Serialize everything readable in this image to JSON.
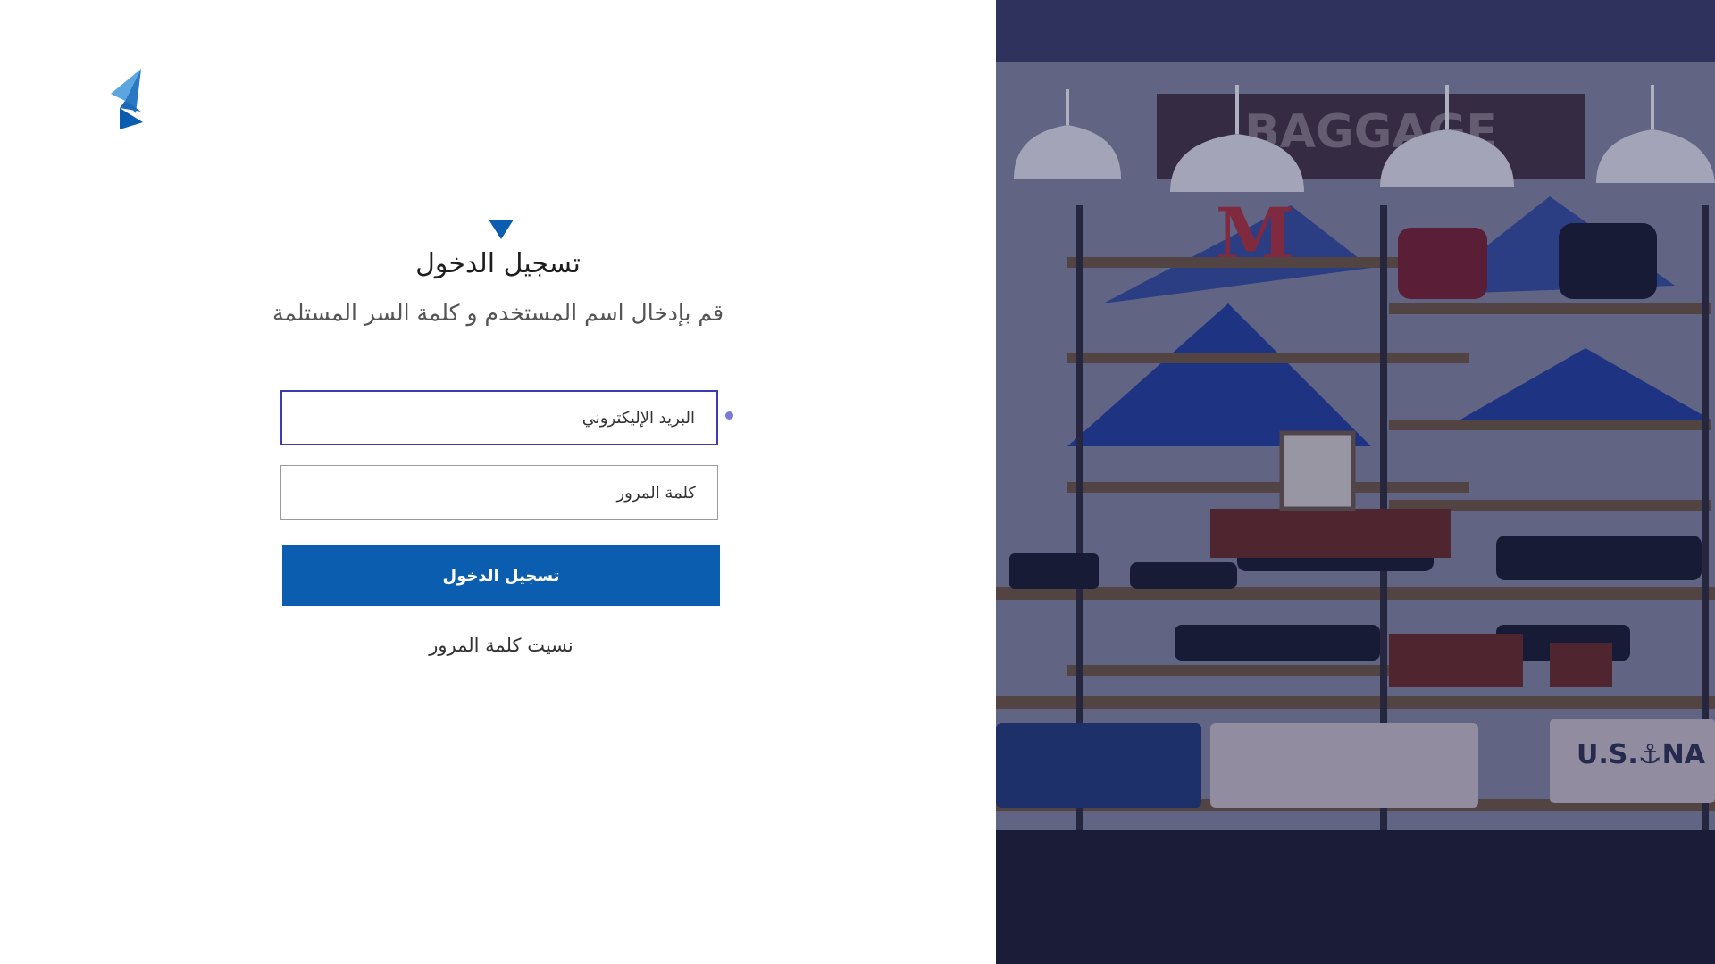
{
  "login": {
    "title": "تسجيل الدخول",
    "subtitle": "قم بإدخال  اسم المستخدم و كلمة السر المستلمة",
    "email_placeholder": "البريد الإليكتروني",
    "password_placeholder": "كلمة المرور",
    "submit_label": "تسجيل الدخول",
    "forgot_label": "نسيت كلمة المرور"
  },
  "photo": {
    "store_sign": "BAGGAGE",
    "shop_letter": "M",
    "shirt_text": "U.S.⚓NA"
  },
  "colors": {
    "brand_blue": "#0b5eaf",
    "logo_light": "#3a8fd6",
    "focus_border": "#3b3bb3",
    "focus_dot": "#7b7bd6",
    "photo_overlay": "#1d1f4a"
  },
  "icons": {
    "logo": "brand-logo",
    "marker": "triangle-down-icon"
  }
}
